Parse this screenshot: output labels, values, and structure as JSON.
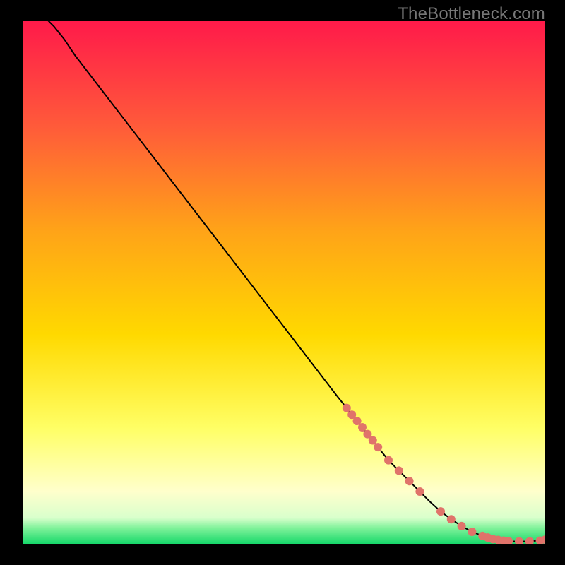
{
  "watermark": "TheBottleneck.com",
  "palette": {
    "bg_black": "#000000",
    "grad_top": "#ff1a4a",
    "grad_mid_upper": "#ff7b2a",
    "grad_mid": "#ffd900",
    "grad_lower": "#ffff66",
    "grad_pale": "#ffffcc",
    "grad_green": "#17d86a",
    "line": "#000000",
    "marker": "#e0736a"
  },
  "chart_data": {
    "type": "line",
    "title": "",
    "xlabel": "",
    "ylabel": "",
    "xlim": [
      0,
      100
    ],
    "ylim": [
      0,
      100
    ],
    "grid": false,
    "legend": false,
    "series": [
      {
        "name": "bottleneck-curve",
        "color": "#000000",
        "x": [
          4,
          6,
          8,
          10,
          15,
          20,
          25,
          30,
          35,
          40,
          45,
          50,
          55,
          60,
          62,
          64,
          66,
          68,
          70,
          72,
          74,
          76,
          78,
          80,
          82,
          84,
          86,
          88,
          90,
          92,
          94,
          96,
          98,
          100
        ],
        "y": [
          101,
          99,
          96.5,
          93.5,
          87,
          80.5,
          74,
          67.5,
          61,
          54.5,
          48,
          41.5,
          35,
          28.5,
          26,
          23.5,
          21,
          18.5,
          16,
          14,
          12,
          10,
          8,
          6.2,
          4.7,
          3.4,
          2.3,
          1.5,
          0.9,
          0.6,
          0.45,
          0.45,
          0.55,
          0.8
        ]
      }
    ],
    "markers": {
      "name": "highlighted-points",
      "color": "#e0736a",
      "x": [
        62,
        63,
        64,
        65,
        66,
        67,
        68,
        70,
        72,
        74,
        76,
        80,
        82,
        84,
        86,
        88,
        89,
        90,
        91,
        92,
        93,
        95,
        97,
        99,
        100
      ],
      "y": [
        26,
        24.7,
        23.5,
        22.3,
        21,
        19.8,
        18.5,
        16,
        14,
        12,
        10,
        6.2,
        4.7,
        3.4,
        2.3,
        1.5,
        1.2,
        0.9,
        0.75,
        0.6,
        0.5,
        0.45,
        0.45,
        0.6,
        0.8
      ]
    }
  }
}
